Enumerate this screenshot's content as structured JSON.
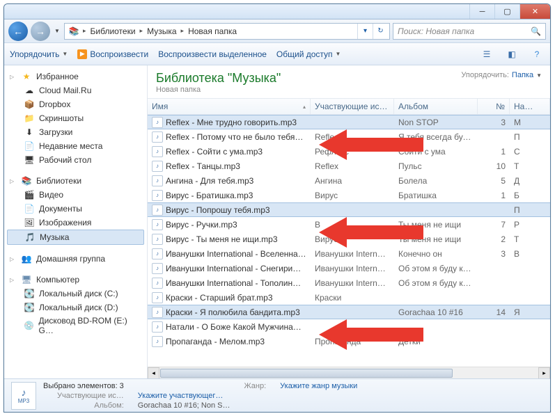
{
  "breadcrumbs": [
    "Библиотеки",
    "Музыка",
    "Новая папка"
  ],
  "search_placeholder": "Поиск: Новая папка",
  "toolbar": {
    "organize": "Упорядочить",
    "play": "Воспроизвести",
    "play_selected": "Воспроизвести выделенное",
    "share": "Общий доступ"
  },
  "sidebar": {
    "favorites": {
      "title": "Избранное",
      "items": [
        {
          "icon": "cloud",
          "label": "Cloud Mail.Ru"
        },
        {
          "icon": "dropbox",
          "label": "Dropbox"
        },
        {
          "icon": "folder",
          "label": "Скриншоты"
        },
        {
          "icon": "downloads",
          "label": "Загрузки"
        },
        {
          "icon": "recent",
          "label": "Недавние места"
        },
        {
          "icon": "desktop",
          "label": "Рабочий стол"
        }
      ]
    },
    "libraries": {
      "title": "Библиотеки",
      "items": [
        {
          "icon": "video",
          "label": "Видео"
        },
        {
          "icon": "docs",
          "label": "Документы"
        },
        {
          "icon": "images",
          "label": "Изображения"
        },
        {
          "icon": "music",
          "label": "Музыка",
          "selected": true
        }
      ]
    },
    "homegroup": {
      "title": "Домашняя группа"
    },
    "computer": {
      "title": "Компьютер",
      "items": [
        {
          "icon": "disk",
          "label": "Локальный диск (C:)"
        },
        {
          "icon": "disk",
          "label": "Локальный диск (D:)"
        },
        {
          "icon": "bd",
          "label": "Дисковод BD-ROM (E:) G…"
        }
      ]
    }
  },
  "library_header": {
    "title": "Библиотека \"Музыка\"",
    "subtitle": "Новая папка",
    "arrange_label": "Упорядочить:",
    "arrange_value": "Папка"
  },
  "columns": {
    "name": "Имя",
    "artist": "Участвующие ис…",
    "album": "Альбом",
    "num": "№",
    "last": "На…"
  },
  "files": [
    {
      "name": "Reflex - Мне трудно говорить.mp3",
      "artist": "",
      "album": "Non STOP",
      "num": "3",
      "last": "M",
      "selected": true
    },
    {
      "name": "Reflex - Потому что не было тебя…",
      "artist": "Refle",
      "album": "Я тебя всегда буду …",
      "num": "",
      "last": "П"
    },
    {
      "name": "Reflex - Сойти с ума.mp3",
      "artist": "Рефлекс",
      "album": "Сойти с ума",
      "num": "1",
      "last": "С"
    },
    {
      "name": "Reflex - Танцы.mp3",
      "artist": "Reflex",
      "album": "Пульс",
      "num": "10",
      "last": "Т"
    },
    {
      "name": "Ангина - Для тебя.mp3",
      "artist": "Ангина",
      "album": "Болела",
      "num": "5",
      "last": "Д"
    },
    {
      "name": "Вирус - Братишка.mp3",
      "artist": "Вирус",
      "album": "Братишка",
      "num": "1",
      "last": "Б"
    },
    {
      "name": "Вирус - Попрошу тебя.mp3",
      "artist": "",
      "album": "",
      "num": "",
      "last": "П",
      "selected": true
    },
    {
      "name": "Вирус - Ручки.mp3",
      "artist": "В",
      "album": "Ты меня не ищи",
      "num": "7",
      "last": "Р"
    },
    {
      "name": "Вирус - Ты меня не ищи.mp3",
      "artist": "Вирус",
      "album": "Ты меня не ищи",
      "num": "2",
      "last": "Т"
    },
    {
      "name": "Иванушки International - Вселенна…",
      "artist": "Иванушки Intern…",
      "album": "Конечно он",
      "num": "3",
      "last": "В"
    },
    {
      "name": "Иванушки International - Снегири…",
      "artist": "Иванушки Intern…",
      "album": "Об этом я буду кр…",
      "num": "",
      "last": ""
    },
    {
      "name": "Иванушки International - Тополин…",
      "artist": "Иванушки Intern…",
      "album": "Об этом я буду кр…",
      "num": "",
      "last": ""
    },
    {
      "name": "Краски - Старший брат.mp3",
      "artist": "Краски",
      "album": "",
      "num": "",
      "last": ""
    },
    {
      "name": "Краски - Я полюбила бандита.mp3",
      "artist": "",
      "album": "Gorachaa 10 #16",
      "num": "14",
      "last": "Я",
      "selected": true
    },
    {
      "name": "Натали - О Боже Какой Мужчина…",
      "artist": "",
      "album": "",
      "num": "",
      "last": ""
    },
    {
      "name": "Пропаганда - Мелом.mp3",
      "artist": "Пропаганда",
      "album": "Детки",
      "num": "",
      "last": ""
    }
  ],
  "status": {
    "selected_count": "Выбрано элементов: 3",
    "artist_label": "Участвующие ис…",
    "artist_val": "Укажите участвующег…",
    "genre_label": "Жанр:",
    "genre_val": "Укажите жанр музыки",
    "album_label": "Альбом:",
    "album_val": "Gorachaa 10 #16; Non S…",
    "thumb_text": "MP3"
  }
}
